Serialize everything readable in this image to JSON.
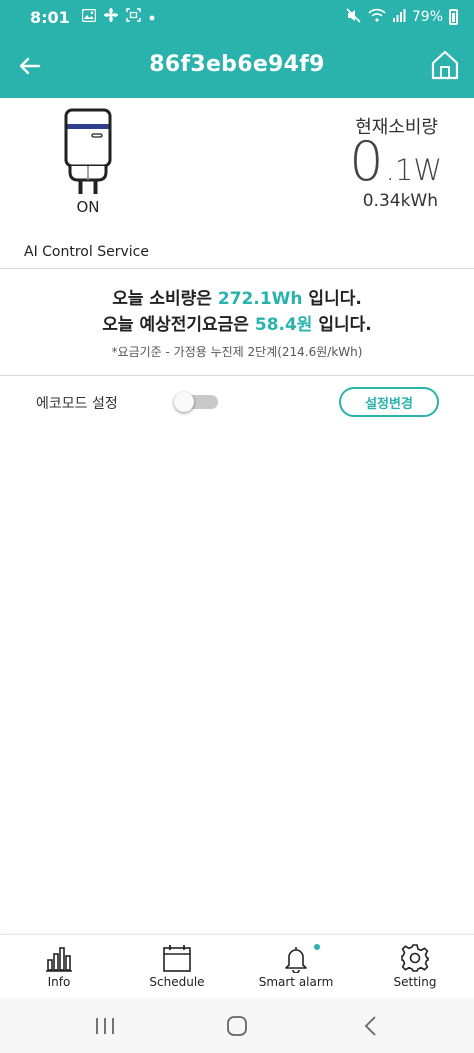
{
  "status_bar": {
    "time": "8:01",
    "battery": "79%",
    "icons": [
      "image-icon",
      "fan-icon",
      "screenshot-icon",
      "dot-icon",
      "mute-icon",
      "wifi-icon",
      "signal-icon",
      "battery-icon"
    ]
  },
  "header": {
    "title": "86f3eb6e94f9",
    "back_icon": "arrow-left-icon",
    "home_icon": "home-icon"
  },
  "device": {
    "state": "ON",
    "icon": "smart-plug-icon"
  },
  "usage": {
    "title": "현재소비량",
    "power_big": "0",
    "power_small": ".1W",
    "energy": "0.34kWh"
  },
  "ai_service_label": "AI Control Service",
  "summary": {
    "line1_prefix": "오늘 소비량은 ",
    "line1_value": "272.1Wh",
    "line1_suffix": " 입니다.",
    "line2_prefix": "오늘 예상전기요금은 ",
    "line2_value": "58.4원",
    "line2_suffix": " 입니다.",
    "note": "*요금기준 - 가정용 누진제 2단계(214.6원/kWh)"
  },
  "eco_mode": {
    "label": "에코모드 설정",
    "enabled": false,
    "button_label": "설정변경"
  },
  "bottom_nav": [
    {
      "label": "Info",
      "icon": "bar-chart-icon"
    },
    {
      "label": "Schedule",
      "icon": "calendar-icon"
    },
    {
      "label": "Smart alarm",
      "icon": "bell-icon",
      "badge": true
    },
    {
      "label": "Setting",
      "icon": "gear-icon"
    }
  ],
  "system_nav": [
    "recents-icon",
    "home-circle-icon",
    "back-chevron-icon"
  ],
  "colors": {
    "accent": "#2ab3ad",
    "plug_stripe": "#2f3f8f"
  }
}
